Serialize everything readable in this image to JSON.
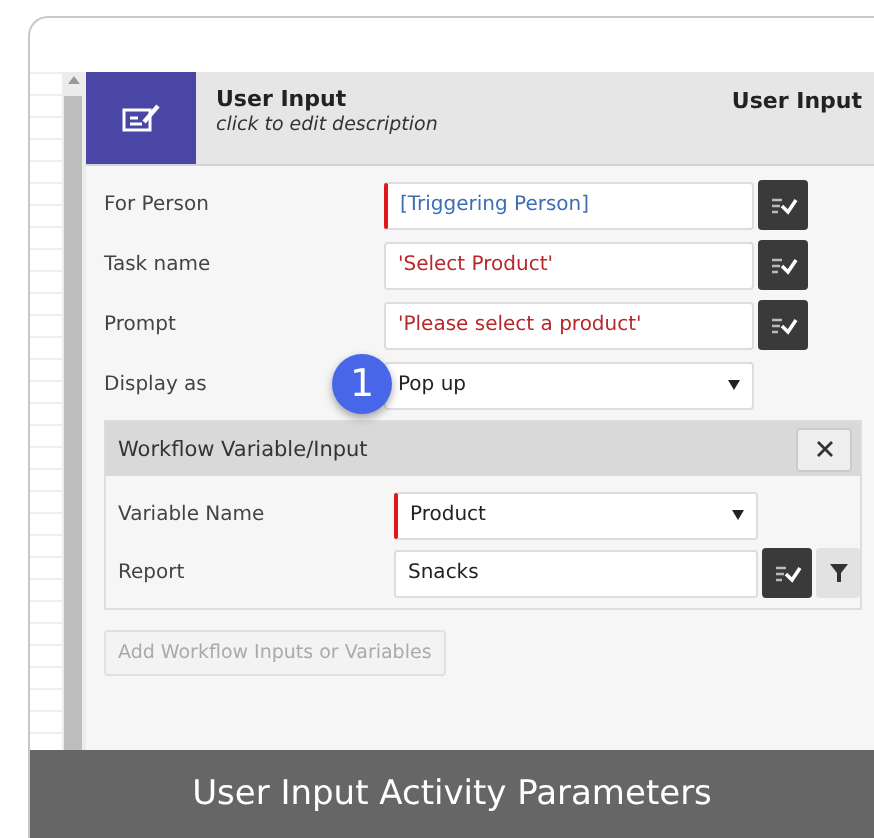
{
  "header": {
    "title": "User Input",
    "description": "click to edit description",
    "type_label": "User Input"
  },
  "fields": [
    {
      "label": "For Person",
      "kind": "reference",
      "value": "[Triggering Person]",
      "required": true
    },
    {
      "label": "Task name",
      "kind": "string",
      "value": "'Select Product'",
      "required": false
    },
    {
      "label": "Prompt",
      "kind": "string",
      "value": "'Please select a product'",
      "required": false
    },
    {
      "label": "Display as",
      "kind": "select",
      "value": "Pop up",
      "required": false
    }
  ],
  "callout": "1",
  "variable_panel": {
    "title": "Workflow Variable/Input",
    "fields": [
      {
        "label": "Variable Name",
        "kind": "select",
        "value": "Product",
        "required": true
      },
      {
        "label": "Report",
        "kind": "report",
        "value": "Snacks",
        "required": false
      }
    ]
  },
  "add_button": {
    "label": "Add Workflow Inputs or Variables",
    "disabled": true
  },
  "caption": "User Input Activity Parameters"
}
